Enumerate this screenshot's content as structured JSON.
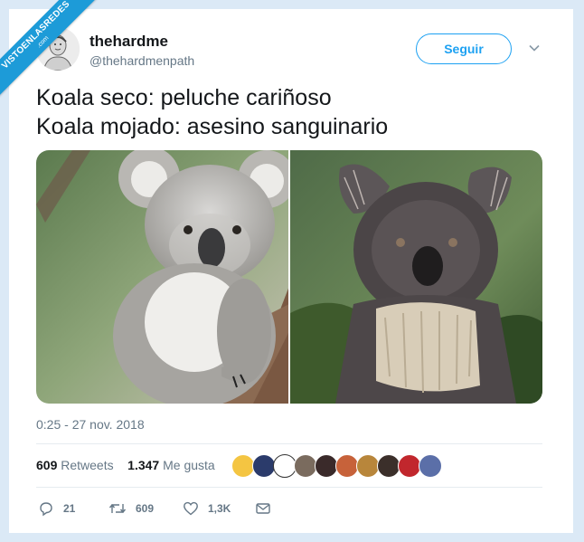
{
  "watermark": {
    "main": "VISTOENLASREDES",
    "sub": ".com"
  },
  "user": {
    "name": "thehardme",
    "handle": "@thehardmenpath"
  },
  "follow_label": "Seguir",
  "tweet": {
    "line1": "Koala seco: peluche cariñoso",
    "line2": "Koala mojado: asesino sanguinario"
  },
  "media": {
    "left_alt": "dry koala hugging a tree",
    "right_alt": "wet koala"
  },
  "timestamp": "0:25 - 27 nov. 2018",
  "stats": {
    "retweets_count": "609",
    "retweets_label": "Retweets",
    "likes_count": "1.347",
    "likes_label": "Me gusta"
  },
  "liker_colors": [
    "#f4c542",
    "#2b3b6b",
    "#ffffff",
    "#7a6b5e",
    "#3a2a2a",
    "#c7623a",
    "#b8863b",
    "#3b2f2a",
    "#c1272d",
    "#5b6fa8"
  ],
  "actions": {
    "replies": "21",
    "retweets": "609",
    "likes": "1,3K"
  },
  "colors": {
    "accent": "#1da1f2",
    "frame": "#dbe9f6",
    "ribbon": "#1d9bd8"
  }
}
